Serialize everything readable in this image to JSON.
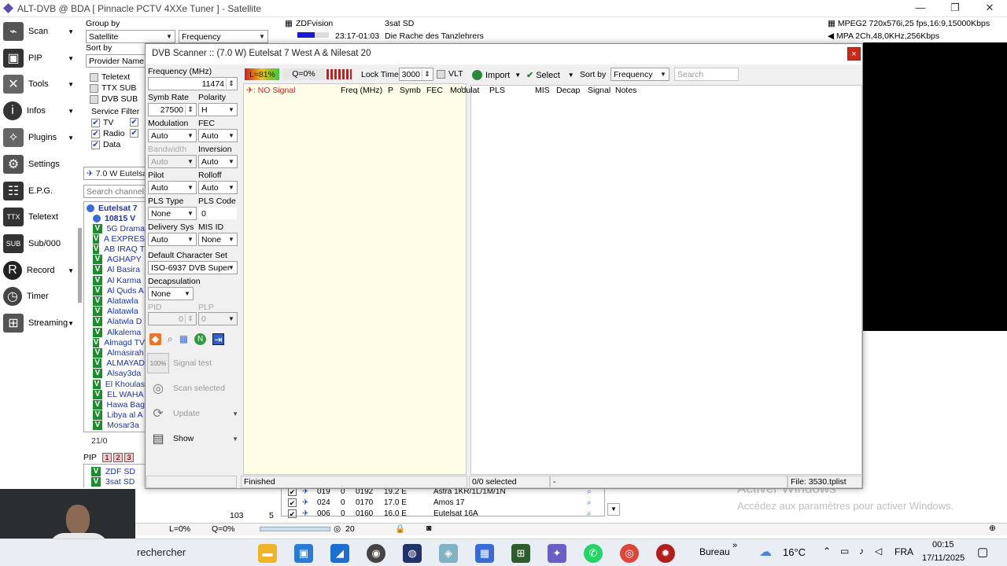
{
  "window": {
    "title": "ALT-DVB @ BDA [ Pinnacle PCTV 4XXe Tuner ] - Satellite"
  },
  "nav": [
    {
      "label": "Scan",
      "icon": "satellite-dish-icon",
      "arrow": true
    },
    {
      "label": "PIP",
      "icon": "pip-icon",
      "arrow": true
    },
    {
      "label": "Tools",
      "icon": "tools-icon",
      "arrow": true
    },
    {
      "label": "Infos",
      "icon": "info-icon",
      "arrow": true
    },
    {
      "label": "Plugins",
      "icon": "plugins-icon",
      "arrow": true
    },
    {
      "label": "Settings",
      "icon": "gear-icon",
      "arrow": false
    },
    {
      "label": "E.P.G.",
      "icon": "epg-icon",
      "arrow": false
    },
    {
      "label": "Teletext",
      "icon": "teletext-icon",
      "arrow": false
    },
    {
      "label": "Sub/000",
      "icon": "subtitle-icon",
      "arrow": false
    },
    {
      "label": "Record",
      "icon": "record-icon",
      "arrow": true
    },
    {
      "label": "Timer",
      "icon": "timer-icon",
      "arrow": false
    },
    {
      "label": "Streaming",
      "icon": "streaming-icon",
      "arrow": true
    }
  ],
  "channel_panel": {
    "group_by_label": "Group by",
    "group_by_value": "Satellite",
    "group_by_second": "Frequency",
    "sort_by_label": "Sort by",
    "sort_by_value": "Provider Name",
    "filters": [
      "Teletext",
      "TTX SUB",
      "DVB SUB"
    ],
    "service_filter_label": "Service Filter",
    "service_filters": [
      "TV",
      "Radio",
      "Data"
    ],
    "satellite_combo": "7.0 W Eutelsa",
    "search_placeholder": "Search channel",
    "tree_satellite": "Eutelsat 7",
    "tree_transponder": "10815 V",
    "channels": [
      "5G Drama",
      "A EXPRES",
      "AB IRAQ T",
      "AGHAPY",
      "Al Basira",
      "Al Karma",
      "Al Quds A",
      "Alatawla",
      "Alatawla",
      "Alatwla D",
      "Alkalema",
      "Almagd TV",
      "Almasirah",
      "ALMAYAD",
      "Alsay3da",
      "El Khoulas",
      "EL WAHA",
      "Hawa Bag",
      "Libya al A",
      "Mosar3a"
    ],
    "count": "21/0",
    "pip_label": "PIP",
    "pip_buttons": [
      "1",
      "2",
      "3"
    ],
    "pip_channels": [
      "ZDF SD",
      "3sat SD"
    ]
  },
  "top_info": {
    "channel_left": "ZDFvision",
    "time": "23:17-01:03",
    "channel_right": "3sat SD",
    "program": "Die Rache des Tanzlehrers",
    "video_info": "MPEG2 720x576i,25 fps,16:9,15000Kbps",
    "audio_info": "MPA 2Ch,48,0KHz,256Kbps"
  },
  "dialog": {
    "title": "DVB Scanner :: (7.0 W) Eutelsat 7 West A & Nilesat 20",
    "close": "×",
    "frequency_label": "Frequency (MHz)",
    "frequency_value": "11474",
    "symb_rate_label": "Symb Rate",
    "symb_rate_value": "27500",
    "polarity_label": "Polarity",
    "polarity_value": "H",
    "modulation_label": "Modulation",
    "modulation_value": "Auto",
    "fec_label": "FEC",
    "fec_value": "Auto",
    "bandwidth_label": "Bandwidth",
    "bandwidth_value": "Auto",
    "inversion_label": "Inversion",
    "inversion_value": "Auto",
    "pilot_label": "Pilot",
    "pilot_value": "Auto",
    "rolloff_label": "Rolloff",
    "rolloff_value": "Auto",
    "pls_type_label": "PLS Type",
    "pls_type_value": "None",
    "pls_code_label": "PLS Code",
    "pls_code_value": "0",
    "delivery_label": "Delivery Sys",
    "delivery_value": "Auto",
    "mis_id_label": "MIS ID",
    "mis_id_value": "None",
    "charset_label": "Default Character Set",
    "charset_value": "ISO-6937 DVB Super",
    "decap_label": "Decapsulation",
    "decap_value": "None",
    "pid_label": "PID",
    "pid_value": "0",
    "plp_label": "PLP",
    "plp_value": "0",
    "signal_test": "Signal test",
    "signal_test_icon_text": "100%",
    "scan_selected": "Scan selected",
    "update": "Update",
    "show": "Show",
    "level": "L=81%",
    "level_fraction": 0.81,
    "quality": "Q=0%",
    "lock_time_label": "Lock Time",
    "lock_time_value": "3000",
    "vlt_label": "VLT",
    "no_signal": ": NO Signal",
    "import_label": "Import",
    "select_label": "Select",
    "sort_by_label": "Sort by",
    "sort_by_value": "Frequency",
    "search_placeholder": "Search",
    "columns": [
      "Freq (MHz)",
      "P",
      "Symb",
      "FEC",
      "Modulat",
      "PLS",
      "MIS",
      "Decap",
      "Signal",
      "Notes"
    ],
    "status_left": "Finished",
    "status_selected": "0/0 selected",
    "status_dash": "-",
    "status_file": "File: 3530.tplist"
  },
  "bottom": {
    "count": "103",
    "count2": "5",
    "level": "L=0%",
    "quality": "Q=0%",
    "volume": "20",
    "transponders": [
      {
        "num": "019",
        "a": "0",
        "b": "0192",
        "pos": "19.2 E",
        "name": "Astra 1KR/1L/1M/1N"
      },
      {
        "num": "024",
        "a": "0",
        "b": "0170",
        "pos": "17.0 E",
        "name": "Amos 17"
      },
      {
        "num": "006",
        "a": "0",
        "b": "0160",
        "pos": "16.0 E",
        "name": "Eutelsat 16A"
      }
    ]
  },
  "watermark": {
    "line1": "Activer Windows",
    "line2": "Accédez aux paramètres pour activer Windows."
  },
  "taskbar": {
    "search_text": "rechercher",
    "desktop_label": "Bureau",
    "temperature": "16°C",
    "language": "FRA",
    "time": "00:15",
    "date": "17/11/2025"
  },
  "colors": {
    "accent": "#1d3fb8",
    "close_red": "#c42b1c",
    "channel_check": "#1c8c2c",
    "yellow_pane": "#fdfde8"
  }
}
